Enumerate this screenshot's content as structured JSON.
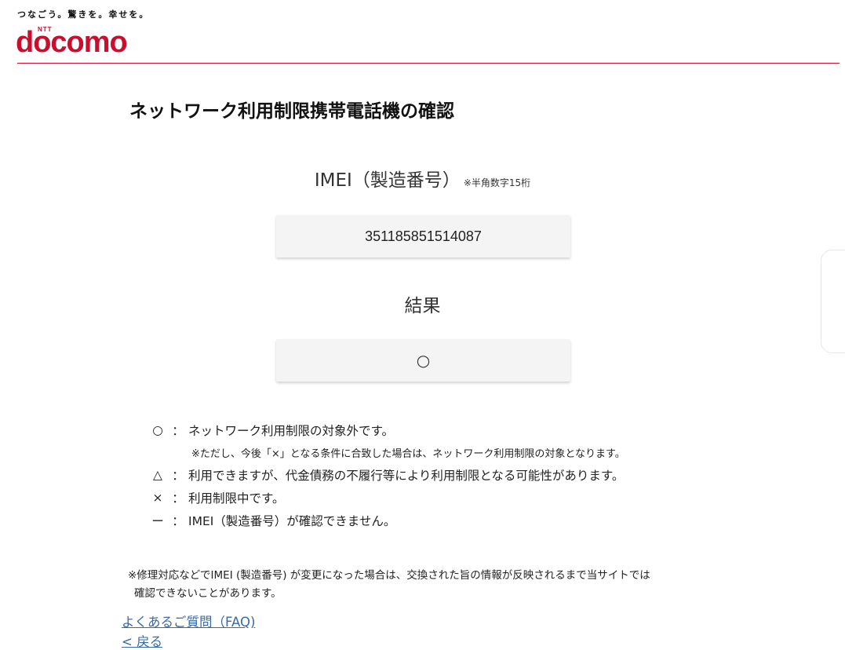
{
  "header": {
    "tagline": "つなごう。驚きを。幸せを。",
    "logo_ntt": "NTT",
    "logo_brand": "docomo",
    "brand_color": "#c8102e"
  },
  "page": {
    "title": "ネットワーク利用制限携帯電話機の確認"
  },
  "imei": {
    "label": "IMEI（製造番号）",
    "note": "※半角数字15桁",
    "value": "351185851514087"
  },
  "result": {
    "label": "結果",
    "value": "○"
  },
  "legend": {
    "items": [
      {
        "symbol": "○",
        "colon": "：",
        "text": "ネットワーク利用制限の対象外です。"
      },
      {
        "symbol": "△",
        "colon": "：",
        "text": "利用できますが、代金債務の不履行等により利用制限となる可能性があります。"
      },
      {
        "symbol": "×",
        "colon": "：",
        "text": "利用制限中です。"
      },
      {
        "symbol": "ー",
        "colon": "：",
        "text": "IMEI（製造番号）が確認できません。"
      }
    ],
    "sub_note": "※ただし、今後「×」となる条件に合致した場合は、ネットワーク利用制限の対象となります。"
  },
  "footnote": {
    "line1": "※修理対応などでIMEI (製造番号) が変更になった場合は、交換された旨の情報が反映されるまで当サイトでは",
    "line2": "確認できないことがあります。"
  },
  "links": {
    "faq": "よくあるご質問（FAQ)",
    "back": "< 戻る",
    "link_color": "#3b6aa0"
  }
}
